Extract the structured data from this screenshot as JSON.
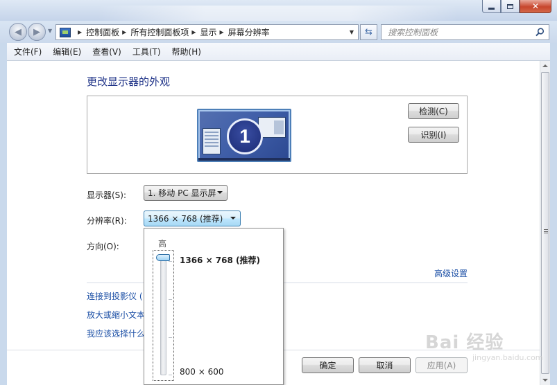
{
  "window": {
    "caption_minimize": "—",
    "caption_close": "✕"
  },
  "navigation": {
    "breadcrumbs": [
      "控制面板",
      "所有控制面板项",
      "显示",
      "屏幕分辨率"
    ],
    "search_placeholder": "搜索控制面板"
  },
  "menu": [
    "文件(F)",
    "编辑(E)",
    "查看(V)",
    "工具(T)",
    "帮助(H)"
  ],
  "page": {
    "title": "更改显示器的外观",
    "monitor_number": "1",
    "detect_button": "检测(C)",
    "identify_button": "识别(I)"
  },
  "form": {
    "display_label": "显示器(S):",
    "display_value": "1. 移动 PC 显示屏",
    "resolution_label": "分辨率(R):",
    "resolution_value": "1366 × 768 (推荐)",
    "orientation_label": "方向(O):",
    "advanced_link": "高级设置"
  },
  "links": [
    "连接到投影仪 (",
    "放大或缩小文本",
    "我应该选择什么"
  ],
  "footer": {
    "ok": "确定",
    "cancel": "取消",
    "apply": "应用(A)"
  },
  "resolution_popup": {
    "high_label": "高",
    "top_option": "1366 × 768 (推荐)",
    "bottom_option": "800 × 600",
    "selected_fraction": 1.0
  },
  "watermark": {
    "main": "Bai  经验",
    "sub": "jingyan.baidu.com"
  }
}
